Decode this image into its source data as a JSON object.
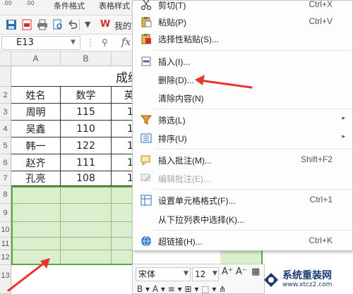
{
  "ribbon": {
    "zero_a": ".00",
    "zero_b": ".00",
    "text1": "条件格式",
    "text2": "表格样式"
  },
  "toolbar": {
    "wps_label": "我的W"
  },
  "name_box": {
    "value": "E13",
    "fx_label": "fx"
  },
  "sheet": {
    "columns": [
      "A",
      "B"
    ],
    "row_numbers": [
      "",
      "",
      "2",
      "3",
      "4",
      "5",
      "6",
      "7",
      "8",
      "9",
      "10",
      "11",
      "12",
      "13"
    ],
    "title": "成绩",
    "headers": [
      "姓名",
      "数学",
      "英"
    ],
    "rows": [
      [
        "周明",
        "115",
        "1"
      ],
      [
        "吴鑫",
        "110",
        "1"
      ],
      [
        "韩一",
        "122",
        "1"
      ],
      [
        "赵齐",
        "111",
        "1"
      ],
      [
        "孔亮",
        "108",
        "1"
      ]
    ],
    "highlight_color": "#d9efce"
  },
  "context_menu": {
    "items": [
      {
        "label": "剪切(T)",
        "shortcut": "Ctrl+X",
        "icon": "scissors-icon"
      },
      {
        "label": "粘贴(P)",
        "shortcut": "Ctrl+V",
        "icon": "paste-icon"
      },
      {
        "label": "选择性粘贴(S)...",
        "shortcut": "",
        "icon": "paste-special-icon"
      },
      {
        "label": "插入(I)...",
        "shortcut": "",
        "icon": "insert-icon"
      },
      {
        "label": "删除(D)...",
        "shortcut": "",
        "icon": ""
      },
      {
        "label": "清除内容(N)",
        "shortcut": "",
        "icon": ""
      },
      {
        "label": "筛选(L)",
        "shortcut": "",
        "icon": "filter-icon"
      },
      {
        "label": "排序(U)",
        "shortcut": "",
        "icon": "sort-icon"
      },
      {
        "label": "插入批注(M)...",
        "shortcut": "Shift+F2",
        "icon": "comment-icon"
      },
      {
        "label": "编辑批注(E)...",
        "shortcut": "",
        "icon": "edit-comment-icon"
      },
      {
        "label": "设置单元格格式(F)...",
        "shortcut": "Ctrl+1",
        "icon": "format-cells-icon"
      },
      {
        "label": "从下拉列表中选择(K)...",
        "shortcut": "",
        "icon": ""
      },
      {
        "label": "超链接(H)...",
        "shortcut": "Ctrl+K",
        "icon": "hyperlink-icon"
      }
    ]
  },
  "mini_toolbar": {
    "font": "宋体",
    "size": "12",
    "grow": "A⁺",
    "shrink": "A⁻",
    "row2": "B ▾ A ▾ ≡ ▾ ⊞ ▾ ⬚ ▾ ⋔"
  },
  "watermark": {
    "name": "系统重装网",
    "url": "www.xtcz2.com"
  },
  "colors": {
    "arrow": "#e8362d",
    "selection": "#5ea63c"
  }
}
